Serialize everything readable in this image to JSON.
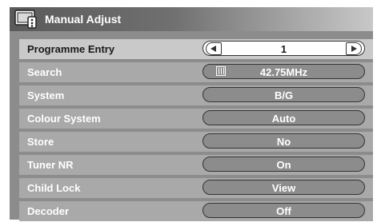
{
  "title": "Manual Adjust",
  "rows": [
    {
      "label": "Programme Entry",
      "value": "1"
    },
    {
      "label": "Search",
      "value": "42.75MHz"
    },
    {
      "label": "System",
      "value": "B/G"
    },
    {
      "label": "Colour System",
      "value": "Auto"
    },
    {
      "label": "Store",
      "value": "No"
    },
    {
      "label": "Tuner NR",
      "value": "On"
    },
    {
      "label": "Child Lock",
      "value": "View"
    },
    {
      "label": "Decoder",
      "value": "Off"
    }
  ],
  "colors": {
    "panel": "#8c8c8c",
    "row": "#a9a9a9",
    "row_selected": "#c9c9c9"
  },
  "icons": {
    "title": "tv-remote-icon",
    "search": "search-mode-icon",
    "left": "arrow-left-icon",
    "right": "arrow-right-icon"
  }
}
